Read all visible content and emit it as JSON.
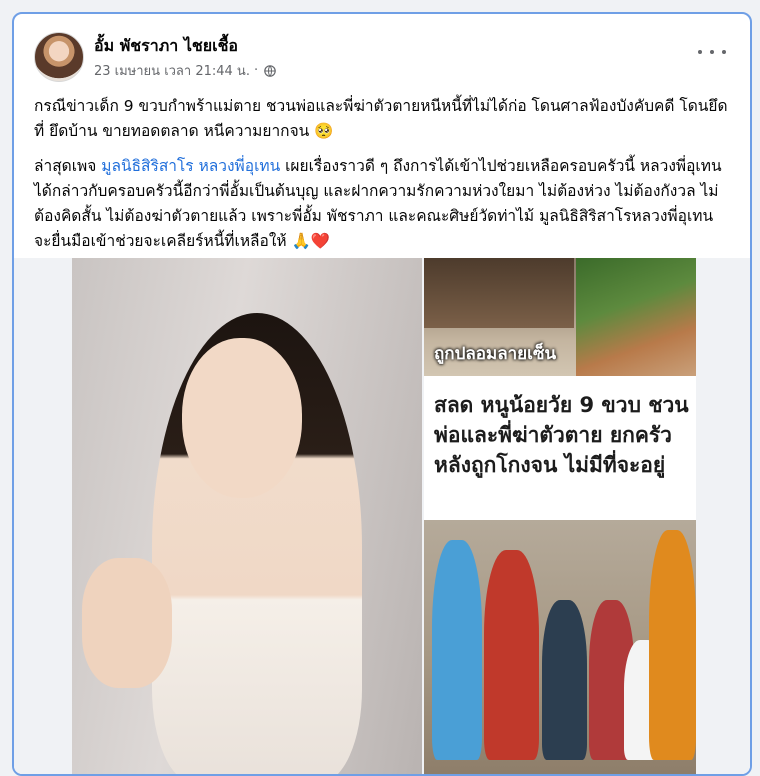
{
  "post": {
    "author": "อั้ม พัชราภา ไชยเชื้อ",
    "date": "23 เมษายน เวลา 21:44 น.",
    "separator": "·",
    "paragraph1": "กรณีข่าวเด็ก 9 ขวบกำพร้าแม่ตาย ชวนพ่อและพี่ฆ่าตัวตายหนีหนี้ที่ไม่ได้ก่อ โดนศาลฟ้องบังคับคดี โดนยึดที่ ยึดบ้าน ขายทอดตลาด หนีความยากจน",
    "paragraph1_emoji": "🥺",
    "paragraph2_prefix": "ล่าสุดเพจ ",
    "paragraph2_link": "มูลนิธิสิริสาโร หลวงพี่อุเทน",
    "paragraph2_rest": " เผยเรื่องราวดี ๆ ถึงการได้เข้าไปช่วยเหลือครอบครัวนี้ หลวงพี่อุเทนได้กล่าวกับครอบครัวนี้อีกว่าพี่อั้มเป็นต้นบุญ และฝากความรักความห่วงใยมา ไม่ต้องห่วง ไม่ต้องกังวล ไม่ต้องคิดสั้น ไม่ต้องฆ่าตัวตายแล้ว เพราะพี่อั้ม พัชราภา และคณะศิษย์วัดท่าไม้ มูลนิธิสิริสาโรหลวงพี่อุเทน จะยื่นมือเข้าช่วยจะเคลียร์หนี้ที่เหลือให้",
    "paragraph2_emoji": "🙏❤️"
  },
  "images": {
    "caption_top": "ถูกปลอมลายเซ็น",
    "headline": "สลด หนูน้อยวัย 9 ขวบ ชวนพ่อและพี่ฆ่าตัวตาย ยกครัว หลังถูกโกงจน ไม่มีที่จะอยู่"
  },
  "colors": {
    "link": "#216fdb",
    "card_border": "#6f9fe6",
    "meta_text": "#65676b"
  },
  "icons": {
    "globe": "globe-icon",
    "more": "more-options-icon"
  }
}
